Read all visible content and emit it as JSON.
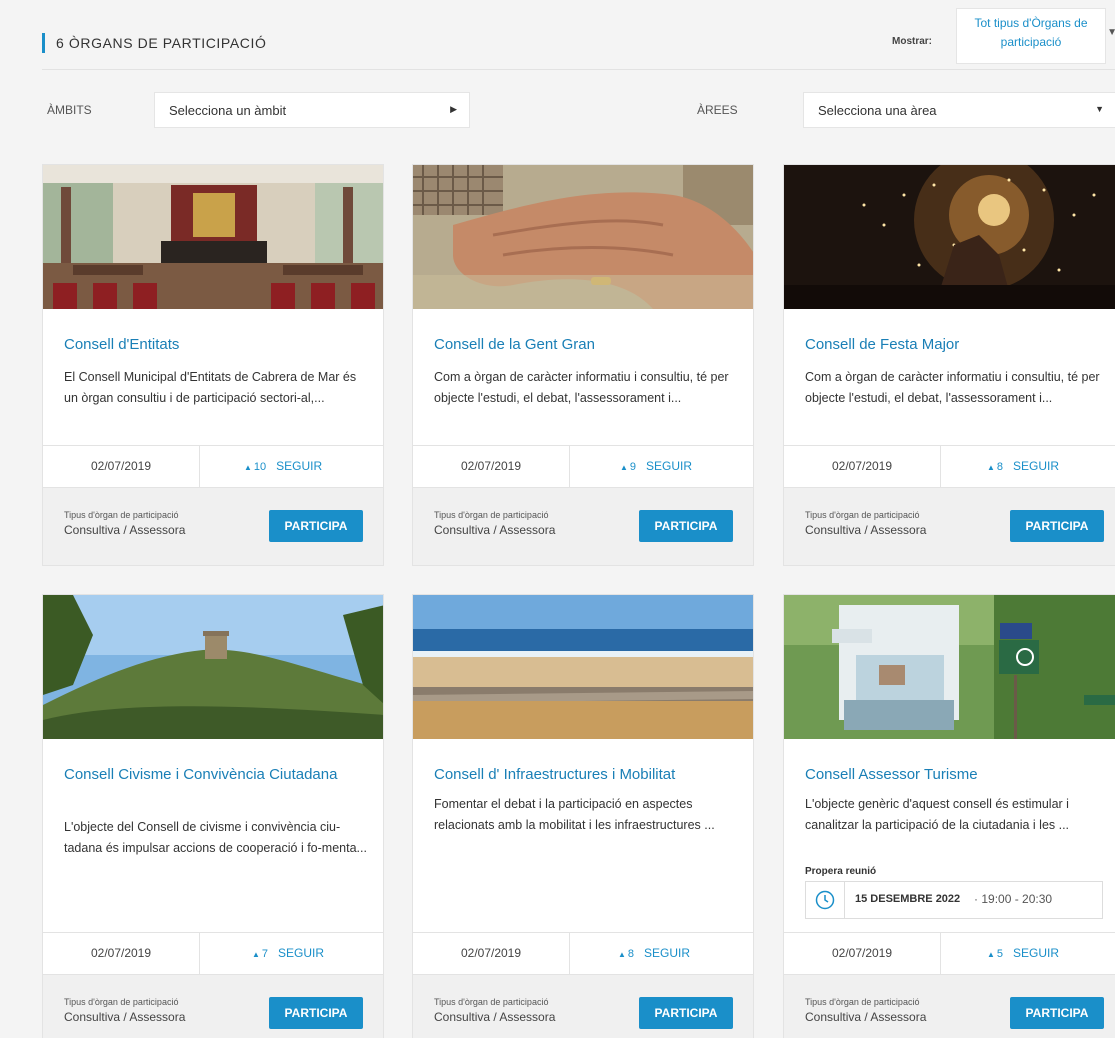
{
  "header": {
    "title": "6 ÒRGANS DE PARTICIPACIÓ",
    "show_label": "Mostrar:",
    "type_select_value": "Tot tipus d'Òrgans de participació"
  },
  "filters": {
    "ambits_label": "ÀMBITS",
    "ambits_value": "Selecciona un àmbit",
    "arees_label": "ÀREES",
    "arees_value": "Selecciona una àrea"
  },
  "common": {
    "follow_label": "SEGUIR",
    "participa_label": "PARTICIPA",
    "type_label": "Tipus d'òrgan de participació"
  },
  "cards": [
    {
      "title": "Consell d'Entitats",
      "description": "El Consell Municipal d'Entitats de Cabrera de Mar és un òrgan consultiu i de participació sectori-al,...",
      "date": "02/07/2019",
      "followers": "10",
      "type": "Consultiva / Assessora",
      "image": "council-chamber"
    },
    {
      "title": "Consell de la Gent Gran",
      "description": "Com a òrgan de caràcter informatiu i consultiu, té per objecte l'estudi, el debat, l'assessorament i...",
      "date": "02/07/2019",
      "followers": "9",
      "type": "Consultiva / Assessora",
      "image": "elderly-hands"
    },
    {
      "title": "Consell de Festa Major",
      "description": "Com a òrgan de caràcter informatiu i consultiu, té per objecte l'estudi, el debat, l'assessorament i...",
      "date": "02/07/2019",
      "followers": "8",
      "type": "Consultiva / Assessora",
      "image": "fire-festival"
    },
    {
      "title": "Consell Civisme i Convivència Ciutadana",
      "description": "L'objecte del Consell de civisme i convivència ciu-tadana és impulsar accions de cooperació i fo-menta...",
      "date": "02/07/2019",
      "followers": "7",
      "type": "Consultiva / Assessora",
      "image": "hill-tower"
    },
    {
      "title": "Consell d' Infraestructures i Mobilitat",
      "description": "Fomentar el debat i la participació en aspectes relacionats amb la mobilitat i les infraestructures ...",
      "date": "02/07/2019",
      "followers": "8",
      "type": "Consultiva / Assessora",
      "image": "beach"
    },
    {
      "title": "Consell Assessor Turisme",
      "description": "L'objecte genèric d'aquest consell és estimular i canalitzar la participació de la ciutadania i les ...",
      "date": "02/07/2019",
      "followers": "5",
      "type": "Consultiva / Assessora",
      "image": "tourist-kiosk",
      "meeting": {
        "label": "Propera reunió",
        "date": "15 DESEMBRE 2022",
        "separator": "·",
        "time": "19:00 - 20:30"
      }
    }
  ]
}
